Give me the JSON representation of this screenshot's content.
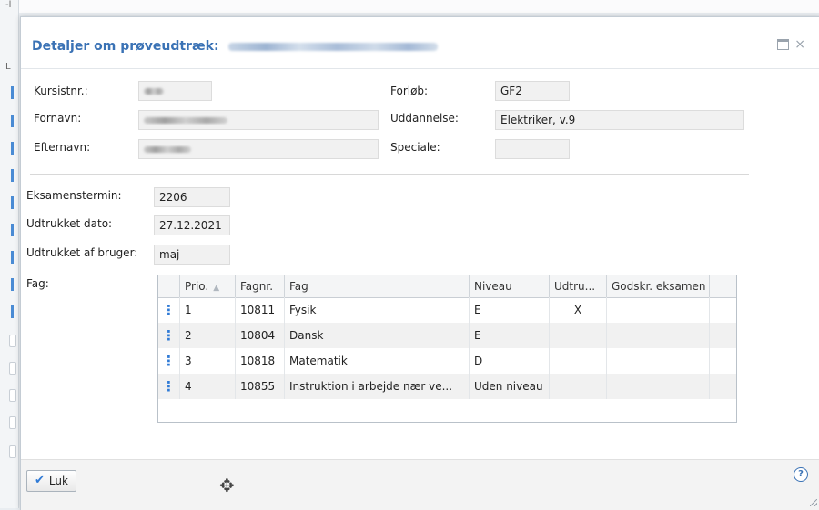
{
  "dialog": {
    "title": "Detaljer om prøveudtræk:",
    "title_name_redacted": "Redacted Name"
  },
  "student": {
    "kursistnr_label": "Kursistnr.:",
    "kursistnr_value": "1234",
    "fornavn_label": "Fornavn:",
    "fornavn_value": "Redacted Name",
    "efternavn_label": "Efternavn:",
    "efternavn_value": "Redacted",
    "forlob_label": "Forløb:",
    "forlob_value": "GF2",
    "uddannelse_label": "Uddannelse:",
    "uddannelse_value": "Elektriker, v.9",
    "speciale_label": "Speciale:",
    "speciale_value": ""
  },
  "exam": {
    "eksamenstermin_label": "Eksamenstermin:",
    "eksamenstermin_value": "2206",
    "udtrukket_dato_label": "Udtrukket dato:",
    "udtrukket_dato_value": "27.12.2021",
    "udtrukket_bruger_label": "Udtrukket af bruger:",
    "udtrukket_bruger_value": "maj",
    "fag_label": "Fag:"
  },
  "grid": {
    "columns": [
      "",
      "Prio.",
      "Fagnr.",
      "Fag",
      "Niveau",
      "Udtru...",
      "Godskr. eksamen"
    ],
    "rows": [
      {
        "menu": "⋮",
        "prio": "1",
        "fagnr": "10811",
        "fag": "Fysik",
        "niveau": "E",
        "udtrukket": "X",
        "godskr": ""
      },
      {
        "menu": "⋮",
        "prio": "2",
        "fagnr": "10804",
        "fag": "Dansk",
        "niveau": "E",
        "udtrukket": "",
        "godskr": ""
      },
      {
        "menu": "⋮",
        "prio": "3",
        "fagnr": "10818",
        "fag": "Matematik",
        "niveau": "D",
        "udtrukket": "",
        "godskr": ""
      },
      {
        "menu": "⋮",
        "prio": "4",
        "fagnr": "10855",
        "fag": "Instruktion i arbejde nær ve...",
        "niveau": "Uden niveau",
        "udtrukket": "",
        "godskr": ""
      }
    ]
  },
  "footer": {
    "luk_label": "Luk"
  },
  "icons": {
    "help": "?",
    "move": "✥",
    "check": "✔",
    "sort_asc": "▲",
    "close": "×"
  },
  "colors": {
    "accent": "#3a72b5",
    "menu": "#2f7ad6"
  }
}
